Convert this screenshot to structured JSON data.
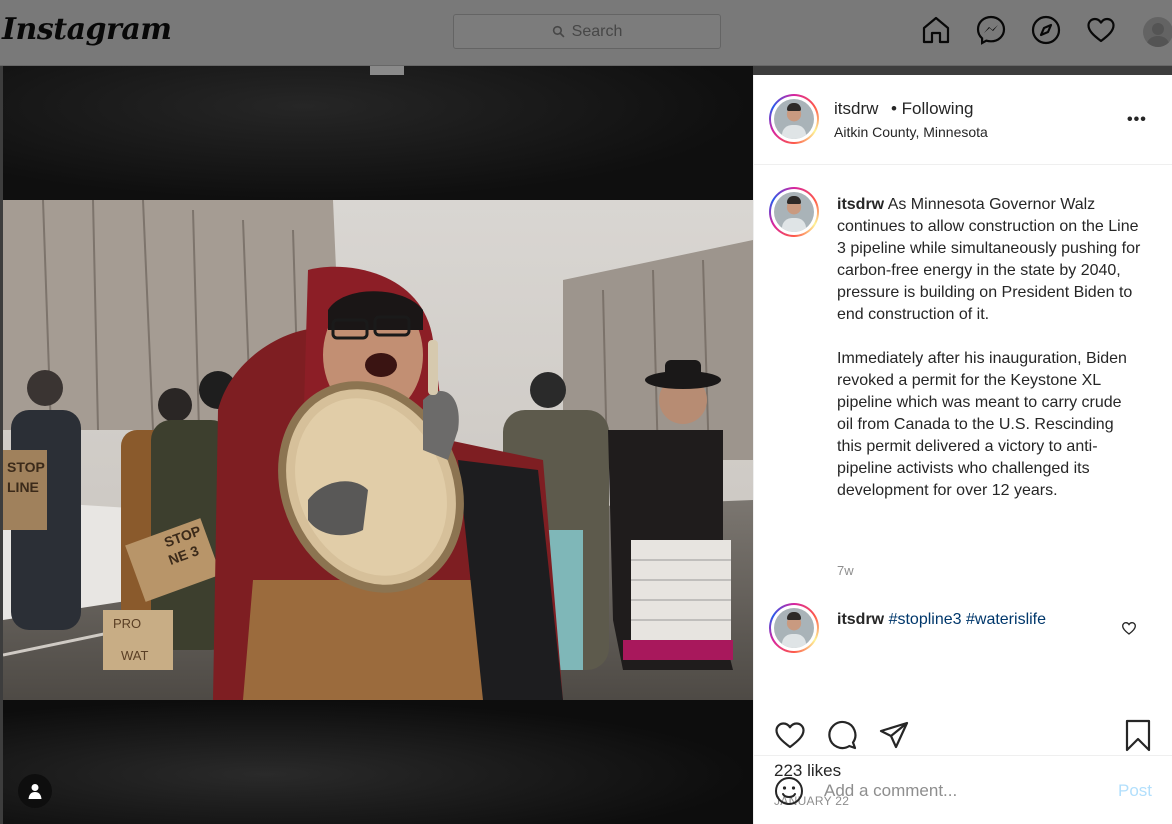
{
  "nav": {
    "logo": "Instagram",
    "search_placeholder": "Search",
    "icons": [
      "home-icon",
      "messenger-icon",
      "explore-icon",
      "heart-icon",
      "profile-avatar"
    ]
  },
  "post": {
    "header": {
      "username": "itsdrw",
      "follow_status": "• Following",
      "location": "Aitkin County, Minnesota",
      "more_label": "•••"
    },
    "caption": {
      "username": "itsdrw",
      "paragraph1": "As Minnesota Governor Walz continues to allow construction on the Line 3 pipeline while simultaneously pushing for carbon-free energy in the state by 2040, pressure is building on President Biden to end construction of it.",
      "paragraph2": "Immediately after his inauguration, Biden revoked a permit for the Keystone XL pipeline which was meant to carry crude oil from Canada to the U.S. Rescinding this permit delivered a victory to anti-pipeline activists who challenged its development for over 12 years.",
      "time": "7w"
    },
    "comment": {
      "username": "itsdrw",
      "tag1": "#stopline3",
      "tag2": "#waterislife"
    },
    "likes": "223 likes",
    "date": "JANUARY 22",
    "comment_placeholder": "Add a comment...",
    "post_button": "Post",
    "sign_texts": [
      "STOP",
      "LINE",
      "STOP",
      "NE 3",
      "PRO",
      "WAT"
    ]
  },
  "colors": {
    "link": "#00376b",
    "post_disabled": "#b2dffc",
    "muted": "#8e8e8e"
  }
}
